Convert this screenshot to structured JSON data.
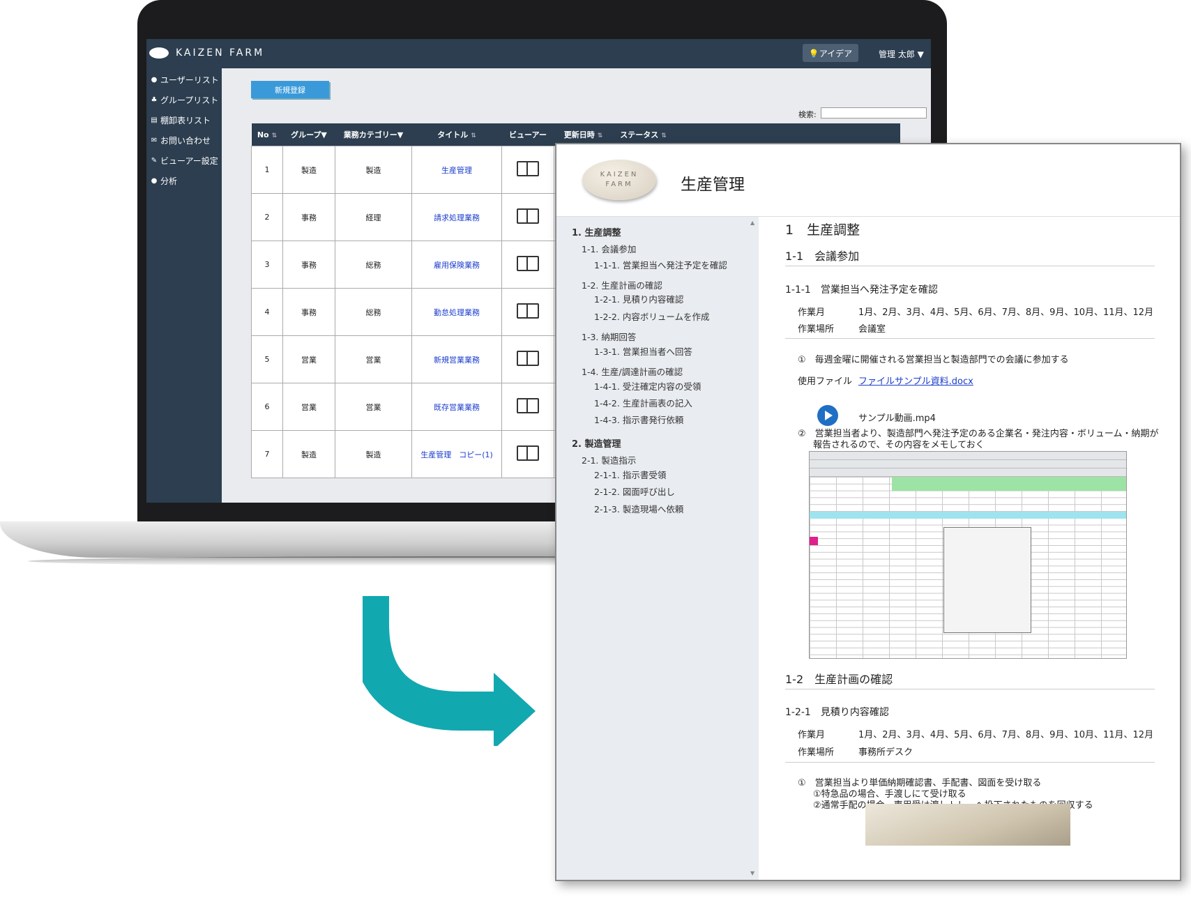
{
  "app": {
    "brand": "KAIZEN FARM",
    "idea_button": "アイデア",
    "user_menu": "管理 太郎 ▼"
  },
  "sidebar": {
    "items": [
      {
        "label": "ユーザーリスト",
        "icon": "user-icon"
      },
      {
        "label": "グループリスト",
        "icon": "group-icon"
      },
      {
        "label": "棚卸表リスト",
        "icon": "list-icon"
      },
      {
        "label": "お問い合わせ",
        "icon": "mail-icon"
      },
      {
        "label": "ビューアー設定",
        "icon": "edit-icon"
      },
      {
        "label": "分析",
        "icon": "chart-icon"
      }
    ]
  },
  "main": {
    "new_button": "新規登録",
    "search_label": "検索:",
    "columns": [
      "No",
      "グループ▼",
      "業務カテゴリー▼",
      "タイトル",
      "ビューアー",
      "更新日時",
      "ステータス"
    ],
    "rows": [
      {
        "no": "1",
        "group": "製造",
        "category": "製造",
        "title": "生産管理"
      },
      {
        "no": "2",
        "group": "事務",
        "category": "経理",
        "title": "請求処理業務"
      },
      {
        "no": "3",
        "group": "事務",
        "category": "総務",
        "title": "雇用保険業務"
      },
      {
        "no": "4",
        "group": "事務",
        "category": "総務",
        "title": "勤怠処理業務"
      },
      {
        "no": "5",
        "group": "営業",
        "category": "営業",
        "title": "新規営業業務"
      },
      {
        "no": "6",
        "group": "営業",
        "category": "営業",
        "title": "既存営業業務"
      },
      {
        "no": "7",
        "group": "製造",
        "category": "製造",
        "title": "生産管理　コピー(1)"
      }
    ]
  },
  "doc": {
    "logo_text_1": "KAIZEN",
    "logo_text_2": "FARM",
    "title": "生産管理",
    "toc": [
      "1. 生産調整",
      "1-1. 会議参加",
      "1-1-1. 営業担当へ発注予定を確認",
      "1-2. 生産計画の確認",
      "1-2-1. 見積り内容確認",
      "1-2-2. 内容ボリュームを作成",
      "1-3. 納期回答",
      "1-3-1. 営業担当者へ回答",
      "1-4. 生産/調達計画の確認",
      "1-4-1. 受注確定内容の受領",
      "1-4-2. 生産計画表の記入",
      "1-4-3. 指示書発行依頼",
      "2. 製造管理",
      "2-1. 製造指示",
      "2-1-1. 指示書受領",
      "2-1-2. 図面呼び出し",
      "2-1-3. 製造現場へ依頼"
    ],
    "content": {
      "h1": "1　生産調整",
      "h2_1": "1-1　会議参加",
      "h3_1": "1-1-1　営業担当へ発注予定を確認",
      "month_label": "作業月",
      "months": "1月、2月、3月、4月、5月、6月、7月、8月、9月、10月、11月、12月",
      "place_label": "作業場所",
      "place_1": "会議室",
      "step_1": "①　毎週金曜に開催される営業担当と製造部門での会議に参加する",
      "file_label": "使用ファイル",
      "file_link": "ファイルサンプル資料.docx",
      "video_name": "サンプル動画.mp4",
      "step_2_line1": "②　営業担当者より、製造部門へ発注予定のある企業名・発注内容・ボリューム・納期が",
      "step_2_line2": "報告されるので、その内容をメモしておく",
      "h2_2": "1-2　生産計画の確認",
      "h3_2": "1-2-1　見積り内容確認",
      "place_2": "事務所デスク",
      "step_3_line1": "①　営業担当より単価納期確認書、手配書、図面を受け取る",
      "step_3_line2": "①特急品の場合、手渡しにて受け取る",
      "step_3_line3": "②通常手配の場合、専用受け渡しトレーへ投下されたものを回収する"
    }
  },
  "colors": {
    "header_bg": "#2c3e50",
    "primary_button": "#3a9ad9",
    "arrow": "#12a8b0",
    "link": "#1a3ccc"
  }
}
